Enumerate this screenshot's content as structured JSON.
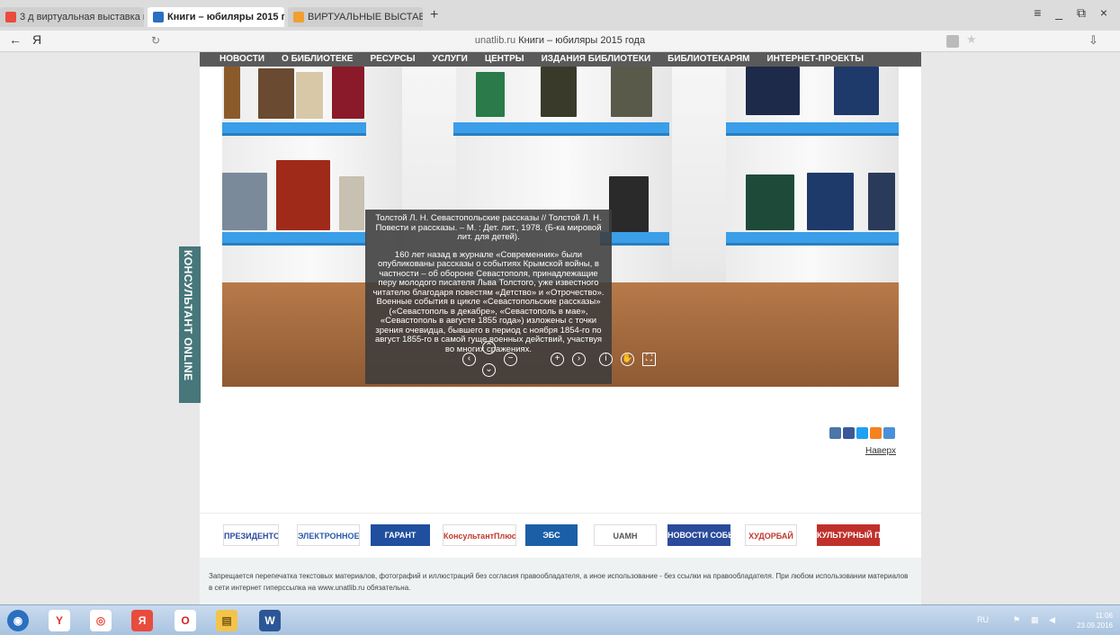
{
  "browser": {
    "tabs": [
      {
        "label": "3 д виртуальная выставка к",
        "active": false
      },
      {
        "label": "Книги – юбиляры 2015 г.",
        "active": true
      },
      {
        "label": "ВИРТУАЛЬНЫЕ ВЫСТАВКИ",
        "active": false
      }
    ],
    "new_tab": "+",
    "window_controls": "≡ _ ⧉ ×",
    "back": "←",
    "home": "Я",
    "reload": "↻",
    "url_domain": "unatlib.ru",
    "url_title": "Книги – юбиляры 2015 года",
    "star": "★",
    "download": "⇩"
  },
  "nav": {
    "items": [
      "НОВОСТИ",
      "О БИБЛИОТЕКЕ",
      "РЕСУРСЫ",
      "УСЛУГИ",
      "ЦЕНТРЫ",
      "ИЗДАНИЯ БИБЛИОТЕКИ",
      "БИБЛИОТЕКАРЯМ",
      "ИНТЕРНЕТ-ПРОЕКТЫ"
    ]
  },
  "tooltip": {
    "citation": "Толстой Л. Н. Севастопольские рассказы // Толстой Л. Н. Повести и рассказы. – М. : Дет. лит., 1978. (Б-ка мировой лит. для детей).",
    "description": "160 лет назад в журнале «Современник» были опубликованы рассказы о событиях Крымской войны, в частности – об обороне Севастополя, принадлежащие перу молодого писателя Льва Толстого, уже известного читателю благодаря повестям «Детство» и «Отрочество». Военные события в цикле «Севастопольские рассказы» («Севастополь в декабре», «Севастополь в мае», «Севастополь в августе 1855 года») изложены с точки зрения очевидца, бывшего в период с ноября 1854-го по август 1855-го в самой гуще военных действий, участвуя во многих сражениях."
  },
  "viewer_controls": {
    "up": "⌃",
    "down": "⌄",
    "zoom_out": "−",
    "zoom_in": "+",
    "left": "‹",
    "right": "›",
    "info": "i",
    "hand": "✋",
    "fullscreen": "⛶"
  },
  "consultant": {
    "label": "КОНСУЛЬТАНТ ONLINE"
  },
  "social": {
    "colors": [
      "#4a76a8",
      "#3b5998",
      "#1da1f2",
      "#f58220",
      "#4a90d9"
    ]
  },
  "to_top": "Наверх",
  "partners": [
    {
      "label": "ПРЕЗИДЕНТСКАЯ БИБЛИОТЕКА",
      "color": "#2b4a9a",
      "bg": "#ffffff"
    },
    {
      "label": "ЭЛЕКТРОННОЕ ПРАВИТЕЛЬСТВО",
      "color": "#2a5aa8",
      "bg": "#ffffff"
    },
    {
      "label": "ГАРАНТ",
      "color": "#ffffff",
      "bg": "#1f4f9e"
    },
    {
      "label": "КонсультантПлюс",
      "color": "#c0392b",
      "bg": "#ffffff"
    },
    {
      "label": "ЭБС",
      "color": "#ffffff",
      "bg": "#1a5fa8"
    },
    {
      "label": "UAMH",
      "color": "#555555",
      "bg": "#ffffff"
    },
    {
      "label": "НОВОСТИ СОБЫТИЯ КУЛЬТУРА",
      "color": "#ffffff",
      "bg": "#2a4b9a"
    },
    {
      "label": "ХУДОРБАЙ",
      "color": "#c0392b",
      "bg": "#ffffff"
    },
    {
      "label": "КУЛЬТУРНЫЙ ПОРТАЛ",
      "color": "#ffffff",
      "bg": "#c0302b"
    }
  ],
  "footer": {
    "text": "Запрещается перепечатка текстовых материалов, фотографий и иллюстраций без согласия правообладателя, а иное использование - без ссылки на правообладателя. При любом использовании материалов в сети интернет гиперссылка на www.unatlib.ru обязательна."
  },
  "taskbar": {
    "apps": [
      {
        "name": "windows-start-icon",
        "glyph": "◉",
        "bg": "#2a6fc0",
        "color": "#ffffff"
      },
      {
        "name": "yandex-browser-icon",
        "glyph": "Y",
        "bg": "#ffffff",
        "color": "#d33"
      },
      {
        "name": "chrome-icon",
        "glyph": "◎",
        "bg": "#ffffff",
        "color": "#e94b3c"
      },
      {
        "name": "yandex-icon",
        "glyph": "Я",
        "bg": "#e94b3c",
        "color": "#ffffff"
      },
      {
        "name": "opera-icon",
        "glyph": "O",
        "bg": "#ffffff",
        "color": "#d6222b"
      },
      {
        "name": "explorer-icon",
        "glyph": "▤",
        "bg": "#f3c44a",
        "color": "#7a5a10"
      },
      {
        "name": "word-icon",
        "glyph": "W",
        "bg": "#2b5797",
        "color": "#ffffff"
      }
    ],
    "lang": "RU",
    "time": "11:06",
    "date": "23.09.2016"
  }
}
